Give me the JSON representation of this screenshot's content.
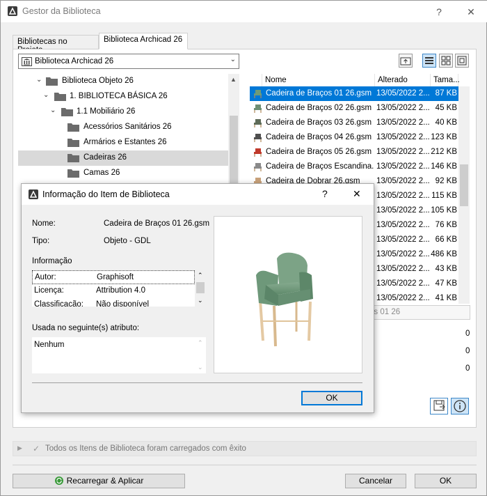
{
  "window": {
    "title": "Gestor da Biblioteca",
    "help_label": "?",
    "close_label": "✕"
  },
  "tabs": [
    {
      "label": "Bibliotecas no Projeto"
    },
    {
      "label": "Biblioteca Archicad 26"
    }
  ],
  "library_select": {
    "value": "Biblioteca Archicad 26"
  },
  "tree": [
    {
      "label": "Biblioteca Objeto 26",
      "level": 0
    },
    {
      "label": "1. BIBLIOTECA BÁSICA 26",
      "level": 1
    },
    {
      "label": "1.1 Mobiliário 26",
      "level": 2
    },
    {
      "label": "Acessórios Sanitários 26",
      "level": 3
    },
    {
      "label": "Armários e Estantes 26",
      "level": 3
    },
    {
      "label": "Cadeiras 26",
      "level": 3,
      "selected": true
    },
    {
      "label": "Camas 26",
      "level": 3
    }
  ],
  "list": {
    "columns": [
      "Nome",
      "Alterado",
      "Tama..."
    ],
    "rows": [
      {
        "name": "Cadeira de Braços 01 26.gsm",
        "date": "13/05/2022 2...",
        "size": "87 KB",
        "selected": true,
        "color": "#6d9a79"
      },
      {
        "name": "Cadeira de Braços 02 26.gsm",
        "date": "13/05/2022 2...",
        "size": "45 KB",
        "color": "#6f8f74"
      },
      {
        "name": "Cadeira de Braços 03 26.gsm",
        "date": "13/05/2022 2...",
        "size": "40 KB",
        "color": "#5e6b58"
      },
      {
        "name": "Cadeira de Braços 04 26.gsm",
        "date": "13/05/2022 2...",
        "size": "123 KB",
        "color": "#4f4f4f"
      },
      {
        "name": "Cadeira de Braços 05 26.gsm",
        "date": "13/05/2022 2...",
        "size": "212 KB",
        "color": "#c0392b"
      },
      {
        "name": "Cadeira de Braços Escandina...",
        "date": "13/05/2022 2...",
        "size": "146 KB",
        "color": "#8a8a8a"
      },
      {
        "name": "Cadeira de Dobrar 26.gsm",
        "date": "13/05/2022 2...",
        "size": "92 KB",
        "color": "#c9a27a"
      },
      {
        "name": "",
        "date": "13/05/2022 2...",
        "size": "115 KB"
      },
      {
        "name": "",
        "date": "13/05/2022 2...",
        "size": "105 KB"
      },
      {
        "name": "",
        "date": "13/05/2022 2...",
        "size": "76 KB"
      },
      {
        "name": "",
        "date": "13/05/2022 2...",
        "size": "66 KB"
      },
      {
        "name": "",
        "date": "13/05/2022 2...",
        "size": "486 KB"
      },
      {
        "name": "",
        "date": "13/05/2022 2...",
        "size": "43 KB"
      },
      {
        "name": "",
        "date": "13/05/2022 2...",
        "size": "47 KB"
      },
      {
        "name": "",
        "date": "13/05/2022 2...",
        "size": "41 KB"
      }
    ]
  },
  "path_field": "os 01 26",
  "counts": [
    "0",
    "0",
    "0"
  ],
  "status": {
    "text": "Todos os Itens de Biblioteca foram carregados com êxito"
  },
  "buttons": {
    "reload": "Recarregar & Aplicar",
    "cancel": "Cancelar",
    "ok": "OK"
  },
  "dialog": {
    "title": "Informação do Item de Biblioteca",
    "help_label": "?",
    "close_label": "✕",
    "name_label": "Nome:",
    "name_value": "Cadeira de Braços 01 26.gsm",
    "type_label": "Tipo:",
    "type_value": "Objeto - GDL",
    "info_label": "Informação",
    "attributes": [
      {
        "key": "Autor:",
        "value": "Graphisoft"
      },
      {
        "key": "Licença:",
        "value": "Attribution 4.0"
      },
      {
        "key": "Classificação:",
        "value": "Não disponível"
      }
    ],
    "used_label": "Usada no seguinte(s) atributo:",
    "used_value": "Nenhum",
    "ok": "OK"
  },
  "colors": {
    "accent": "#0078d7",
    "chair_green": "#6d9a79",
    "chair_wood": "#e4c9a3"
  }
}
